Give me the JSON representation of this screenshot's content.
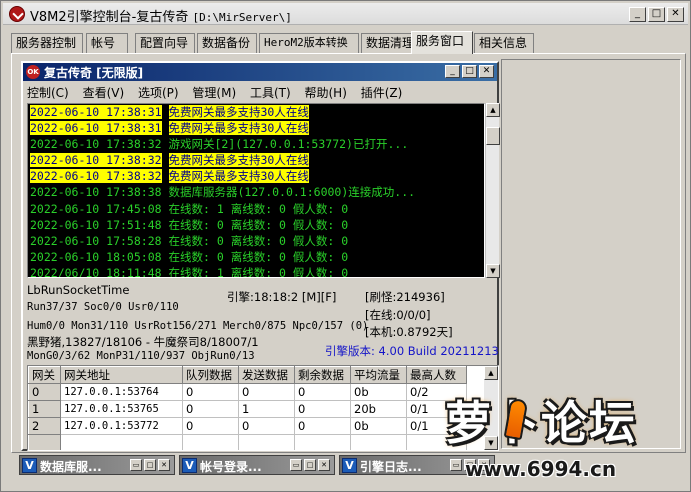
{
  "window": {
    "title": "V8M2引擎控制台-复古传奇",
    "path": "[D:\\MirServer\\]",
    "controls": {
      "minimize": "_",
      "maximize": "□",
      "close": "✕"
    }
  },
  "tabs": [
    {
      "label": "服务器控制"
    },
    {
      "label": "帐号"
    },
    {
      "label": "配置向导"
    },
    {
      "label": "数据备份"
    },
    {
      "label": "HeroM2版本转换"
    },
    {
      "label": "数据清理"
    },
    {
      "label": "服务窗口",
      "active": true
    },
    {
      "label": "相关信息"
    }
  ],
  "child": {
    "icon_text": "OK",
    "title": "复古传奇 [无限版]",
    "controls": {
      "minimize": "_",
      "maximize": "□",
      "close": "✕"
    },
    "menu": [
      "控制(C)",
      "查看(V)",
      "选项(P)",
      "管理(M)",
      "工具(T)",
      "帮助(H)",
      "插件(Z)"
    ]
  },
  "log": [
    {
      "time": "2022-06-10 17:38:31",
      "msg": "免费网关最多支持30人在线",
      "highlight": true
    },
    {
      "time": "2022-06-10 17:38:31",
      "msg": "免费网关最多支持30人在线",
      "highlight": true
    },
    {
      "time": "2022-06-10 17:38:32",
      "msg": "游戏网关[2](127.0.0.1:53772)已打开...",
      "highlight": false
    },
    {
      "time": "2022-06-10 17:38:32",
      "msg": "免费网关最多支持30人在线",
      "highlight": true
    },
    {
      "time": "2022-06-10 17:38:32",
      "msg": "免费网关最多支持30人在线",
      "highlight": true
    },
    {
      "time": "2022-06-10 17:38:38",
      "msg": "数据库服务器(127.0.0.1:6000)连接成功...",
      "highlight": false
    },
    {
      "time": "2022-06-10 17:45:08",
      "msg": "在线数: 1 离线数: 0 假人数: 0",
      "highlight": false
    },
    {
      "time": "2022-06-10 17:51:48",
      "msg": "在线数: 0 离线数: 0 假人数: 0",
      "highlight": false
    },
    {
      "time": "2022-06-10 17:58:28",
      "msg": "在线数: 0 离线数: 0 假人数: 0",
      "highlight": false
    },
    {
      "time": "2022-06-10 18:05:08",
      "msg": "在线数: 0 离线数: 0 假人数: 0",
      "highlight": false
    },
    {
      "time": "2022/06/10 18:11:48",
      "msg": "在线数: 1 离线数: 0 假人数: 0",
      "highlight": false
    }
  ],
  "status": {
    "line1": "LbRunSocketTime",
    "line2": "Run37/37 Soc0/0 Usr0/110",
    "line3": "Hum0/0 Mon31/110 UsrRot156/271 Merch0/875 Npc0/157 (0)",
    "line4": "黑野猪,13827/18106 - 牛魔祭司8/18007/1",
    "line5": "MonG0/3/62 MonP31/110/937 ObjRun0/13",
    "engine_time": "引擎:18:18:2 [M][F]",
    "refresh": "[刷怪:214936]",
    "online": "[在线:0/0/0]",
    "machine": "[本机:0.8792天]",
    "version": "引擎版本: 4.00 Build 20211213"
  },
  "gateway": {
    "columns": [
      "网关",
      "网关地址",
      "队列数据",
      "发送数据",
      "剩余数据",
      "平均流量",
      "最高人数"
    ],
    "rows": [
      [
        "0",
        "127.0.0.1:53764",
        "0",
        "0",
        "0",
        "0b",
        "0/2"
      ],
      [
        "1",
        "127.0.0.1:53765",
        "0",
        "1",
        "0",
        "20b",
        "0/1"
      ],
      [
        "2",
        "127.0.0.1:53772",
        "0",
        "0",
        "0",
        "0b",
        "0/1"
      ]
    ]
  },
  "minimized": [
    {
      "title": "数据库服..."
    },
    {
      "title": "帐号登录..."
    },
    {
      "title": "引擎日志..."
    }
  ],
  "watermark": {
    "logo_left": "萝",
    "logo_right": "卜论坛",
    "url": "www.6994.cn"
  }
}
